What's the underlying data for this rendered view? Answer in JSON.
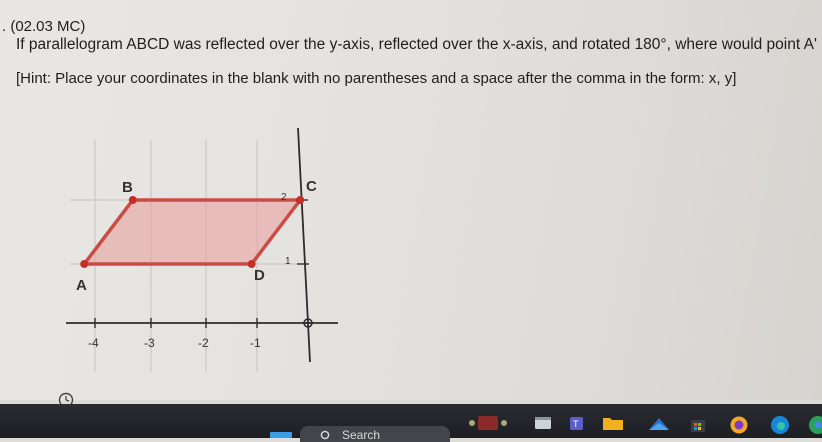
{
  "question": {
    "number": ". (02.03 MC)",
    "text": "If parallelogram ABCD was reflected over the y-axis, reflected over the x-axis, and rotated 180°, where would point A' lie?",
    "hint": "[Hint: Place your coordinates in the blank with no parentheses and a space after the comma in the form: x, y]"
  },
  "graph": {
    "x_ticks": [
      "-4",
      "-3",
      "-2",
      "-1"
    ],
    "y_ticks": [
      "2",
      "1"
    ],
    "points": [
      {
        "label": "A",
        "x": -4.2,
        "y": 1
      },
      {
        "label": "B",
        "x": -3.3,
        "y": 2
      },
      {
        "label": "C",
        "x": -0.2,
        "y": 2
      },
      {
        "label": "D",
        "x": -1.1,
        "y": 1
      }
    ],
    "colors": {
      "edge": "#c94d44",
      "fill": "#e8a2a0",
      "point": "#c62f28",
      "axis": "#2c2c2c",
      "grid": "#c9c9c9"
    }
  },
  "taskbar": {
    "search_label": "Search",
    "apps": [
      "widgets-icon",
      "file-explorer-icon",
      "task-view-icon",
      "teams-icon",
      "folder-icon",
      "mail-icon",
      "store-icon",
      "firefox-icon",
      "edge-icon",
      "chrome-icon"
    ]
  }
}
